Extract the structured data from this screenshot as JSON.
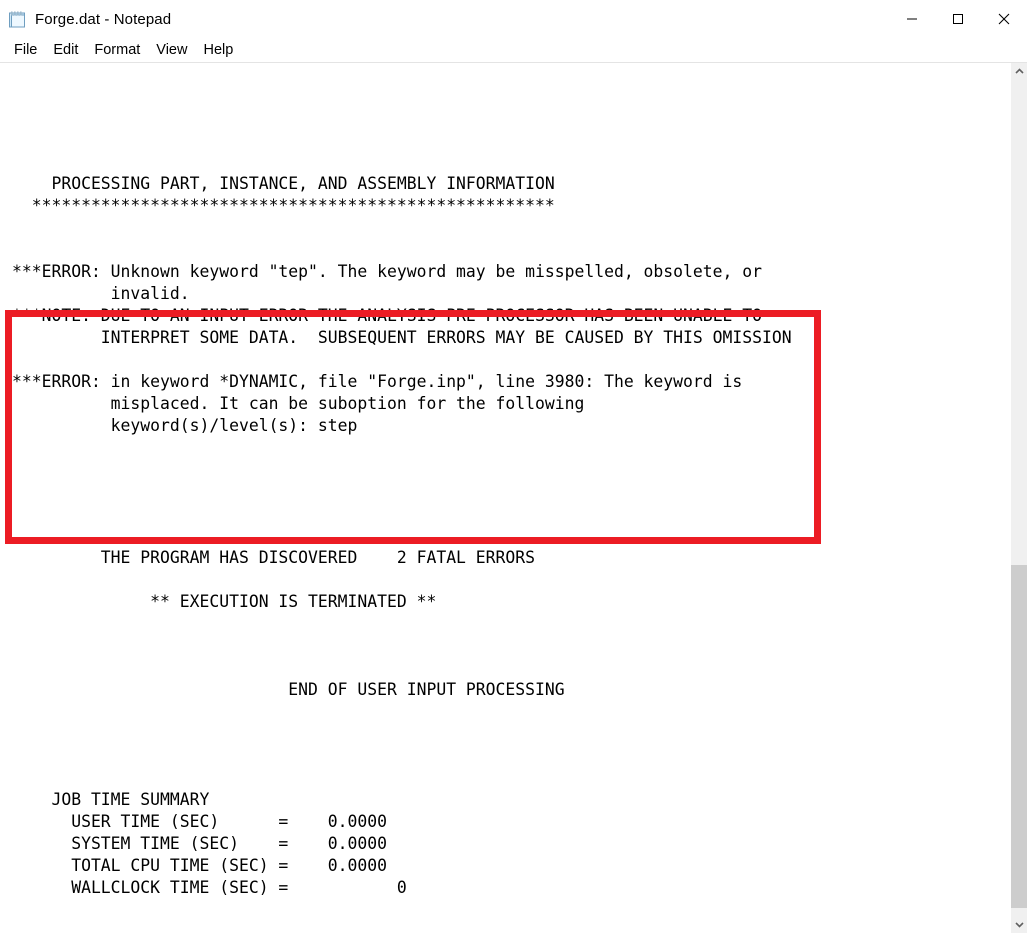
{
  "window": {
    "title": "Forge.dat - Notepad",
    "icon": "notepad-icon"
  },
  "window_controls": {
    "minimize": "minimize-icon",
    "maximize": "maximize-icon",
    "close": "close-icon"
  },
  "menu": {
    "items": [
      {
        "label": "File"
      },
      {
        "label": "Edit"
      },
      {
        "label": "Format"
      },
      {
        "label": "View"
      },
      {
        "label": "Help"
      }
    ]
  },
  "annotation": {
    "color": "#ec1c24",
    "shape": "rectangle-highlight"
  },
  "scrollbar": {
    "up_arrow": "chevron-up-icon",
    "down_arrow": "chevron-down-icon",
    "thumb_top_pct": 58,
    "thumb_height_pct": 41
  },
  "document": {
    "text": "\n\n\n\n\n    PROCESSING PART, INSTANCE, AND ASSEMBLY INFORMATION\n  *****************************************************\n\n\n***ERROR: Unknown keyword \"tep\". The keyword may be misspelled, obsolete, or\n          invalid.\n***NOTE: DUE TO AN INPUT ERROR THE ANALYSIS PRE-PROCESSOR HAS BEEN UNABLE TO\n         INTERPRET SOME DATA.  SUBSEQUENT ERRORS MAY BE CAUSED BY THIS OMISSION\n\n***ERROR: in keyword *DYNAMIC, file \"Forge.inp\", line 3980: The keyword is\n          misplaced. It can be suboption for the following\n          keyword(s)/level(s): step\n\n\n\n\n\n         THE PROGRAM HAS DISCOVERED    2 FATAL ERRORS\n\n              ** EXECUTION IS TERMINATED **\n\n\n\n                            END OF USER INPUT PROCESSING\n\n\n\n\n    JOB TIME SUMMARY\n      USER TIME (SEC)      =    0.0000\n      SYSTEM TIME (SEC)    =    0.0000\n      TOTAL CPU TIME (SEC) =    0.0000\n      WALLCLOCK TIME (SEC) =           0\n"
  }
}
